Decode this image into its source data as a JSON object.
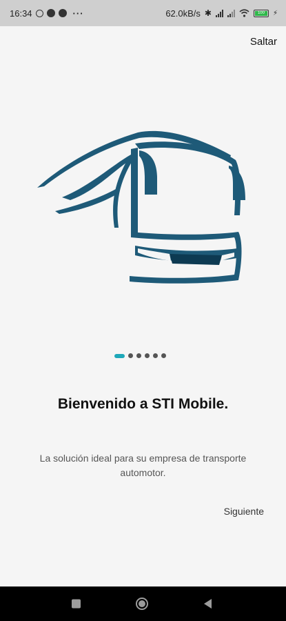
{
  "status_bar": {
    "time": "16:34",
    "net_speed": "62.0kB/s",
    "more": "···",
    "battery_label": "100"
  },
  "onboarding": {
    "skip_label": "Saltar",
    "title": "Bienvenido a STI Mobile.",
    "subtitle": "La solución ideal para su empresa de transporte automotor.",
    "next_label": "Siguiente",
    "pages_total": 6,
    "current_page": 1
  },
  "colors": {
    "bus_illustration": "#1e5a78",
    "indicator_active": "#1ea8b9",
    "indicator_inactive": "#555555",
    "background": "#f5f5f5"
  }
}
